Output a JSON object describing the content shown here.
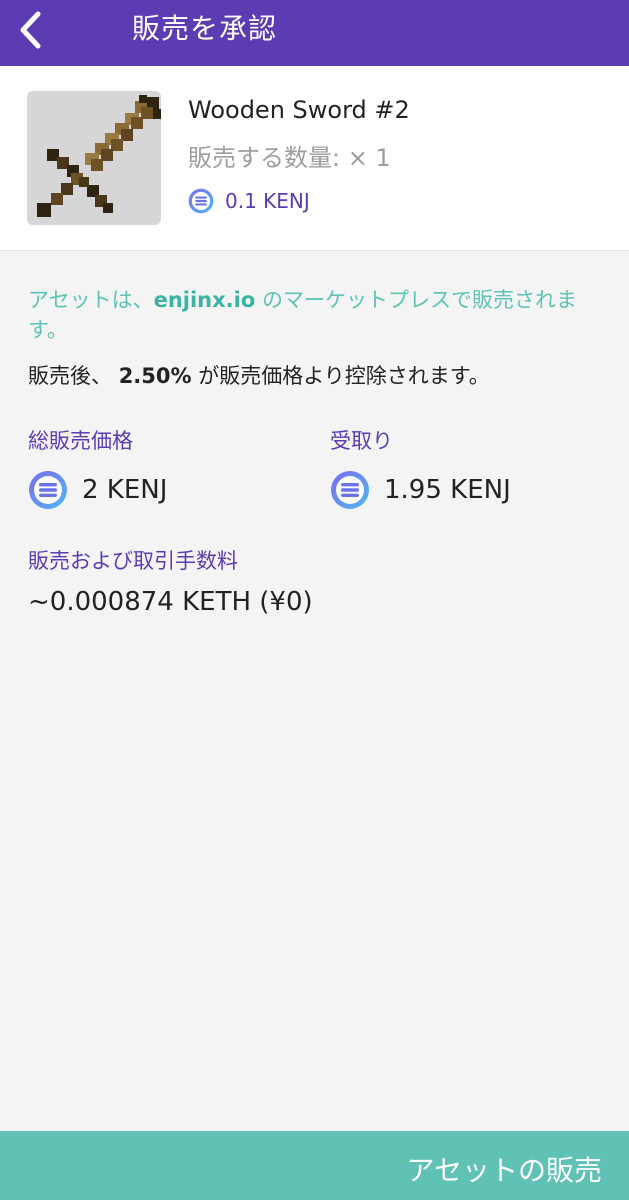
{
  "header": {
    "title": "販売を承認"
  },
  "item": {
    "name": "Wooden Sword #2",
    "quantity_text": "販売する数量: × 1",
    "price_text": "0.1 KENJ"
  },
  "info": {
    "marketplace_prefix": "アセットは、",
    "marketplace_link": "enjinx.io",
    "marketplace_suffix": " のマーケットプレスで販売されます。",
    "fee_prefix": "販売後、 ",
    "fee_percent": "2.50%",
    "fee_suffix": " が販売価格より控除されます。"
  },
  "totals": {
    "total_label": "総販売価格",
    "total_value": "2 KENJ",
    "receive_label": "受取り",
    "receive_value": "1.95 KENJ"
  },
  "fees": {
    "label": "販売および取引手数料",
    "value": "~0.000874 KETH (¥0)"
  },
  "action": {
    "label": "アセットの販売"
  },
  "colors": {
    "header_bg": "#5b3cb3",
    "accent_teal": "#5fc2b5",
    "label_purple": "#5b3cb3"
  },
  "icons": {
    "back": "chevron-left-icon",
    "token": "enjin-coin-icon"
  }
}
